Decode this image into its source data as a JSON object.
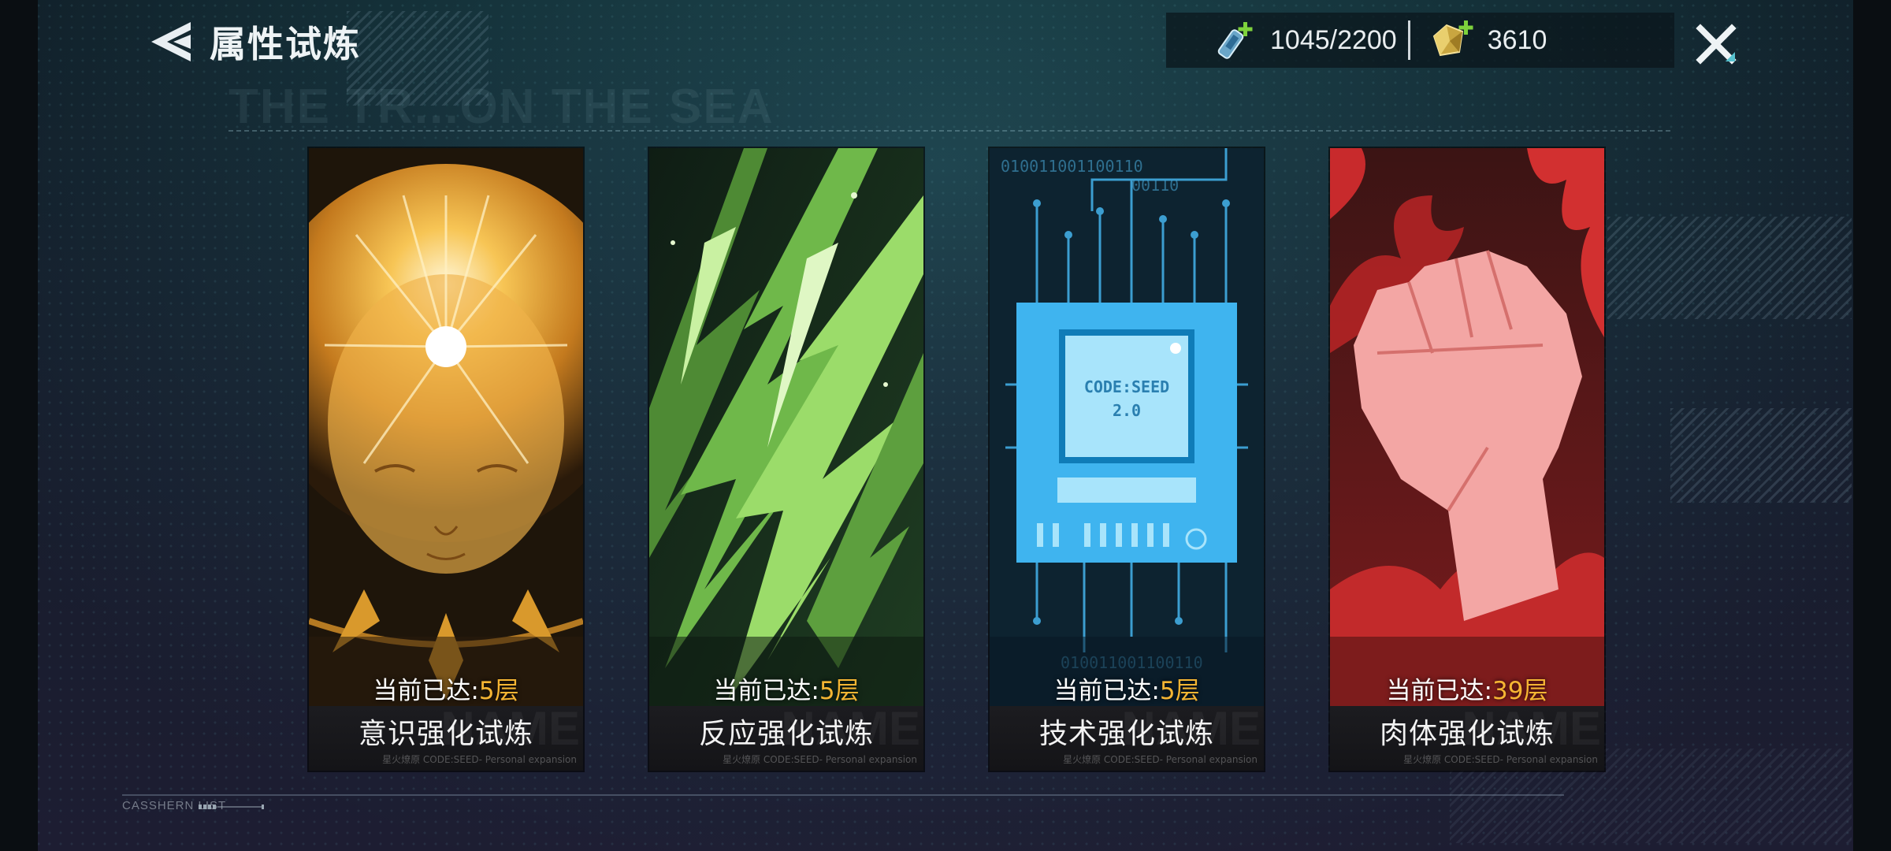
{
  "header": {
    "title": "属性试炼",
    "background_caption": "THE TR...ON THE SEA"
  },
  "resources": {
    "stamina": {
      "icon": "stamina-vial-plus-icon",
      "value": "1045/2200"
    },
    "crystal": {
      "icon": "crystal-cube-plus-icon",
      "value": "3610"
    }
  },
  "trials": [
    {
      "name": "意识强化试炼",
      "progress_label": "当前已达:",
      "progress_value": "5层",
      "art": "glowing-mind-face",
      "accent": "#f2b33a"
    },
    {
      "name": "反应强化试炼",
      "progress_label": "当前已达:",
      "progress_value": "5层",
      "art": "green-lightning-shards",
      "accent": "#7fd24a"
    },
    {
      "name": "技术强化试炼",
      "progress_label": "当前已达:",
      "progress_value": "5层",
      "art": "circuit-chip",
      "accent": "#3fb8f0"
    },
    {
      "name": "肉体强化试炼",
      "progress_label": "当前已达:",
      "progress_value": "39层",
      "art": "red-raised-fist",
      "accent": "#e0393a"
    }
  ],
  "card_watermark": "NAME",
  "card_subtitle": "星火燎原 CODE:SEED- Personal expansion",
  "chip_label": [
    "CODE:SEED",
    "2.0"
  ],
  "binary_text": [
    "010011001100110",
    "00110"
  ],
  "footer": {
    "label": "CASSHERN LIST"
  },
  "colors": {
    "progress_value": "#f5b533",
    "text": "#eef3f5"
  }
}
